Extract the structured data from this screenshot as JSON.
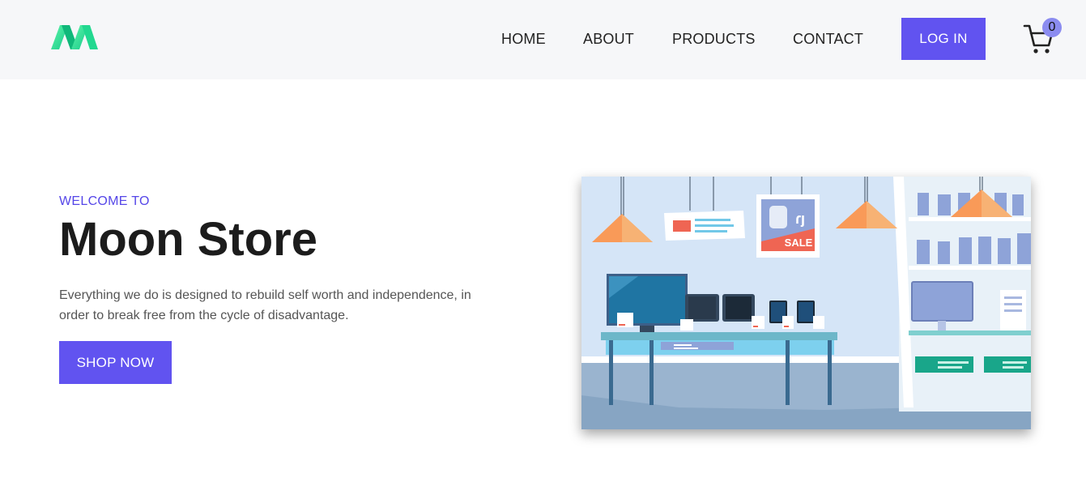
{
  "nav": {
    "logo_icon": "m-logo-icon",
    "links": [
      "HOME",
      "ABOUT",
      "PRODUCTS",
      "CONTACT"
    ],
    "login_label": "LOG IN",
    "cart_icon": "cart-icon",
    "cart_count": "0"
  },
  "hero": {
    "eyebrow": "WELCOME TO",
    "title": "Moon Store",
    "description": "Everything we do is designed to rebuild self worth and independence, in order to break free from the cycle of disadvantage.",
    "cta_label": "SHOP NOW",
    "image_sign_text": "SALE"
  },
  "colors": {
    "accent": "#6153f0",
    "nav_bg": "#f6f7f9",
    "badge": "#8b8cf0",
    "logo_green": "#2ee59d"
  }
}
